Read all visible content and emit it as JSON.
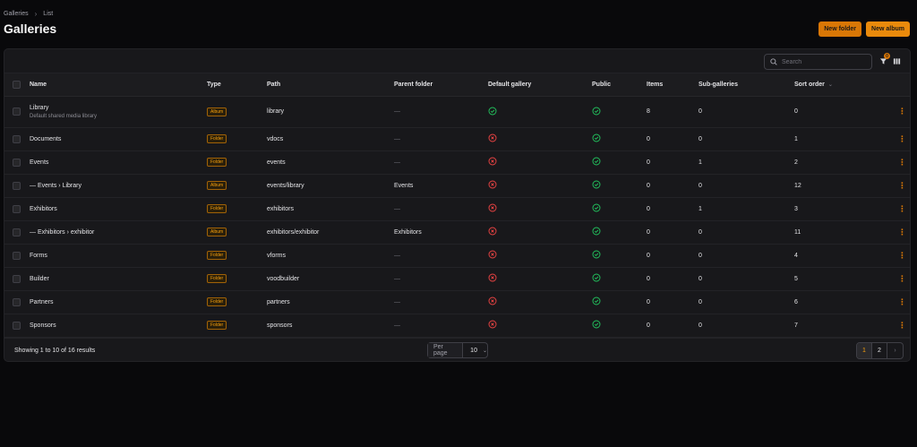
{
  "breadcrumb": {
    "items": [
      "Galleries",
      "List"
    ],
    "separator": "›"
  },
  "page": {
    "title": "Galleries"
  },
  "actions": {
    "new_folder": "New folder",
    "new_album": "New album"
  },
  "toolbar": {
    "search_placeholder": "Search",
    "filter_count": "0",
    "icons": {
      "search": "search-icon",
      "filter": "funnel-icon",
      "columns": "columns-icon"
    }
  },
  "table": {
    "headers": {
      "name": "Name",
      "type": "Type",
      "path": "Path",
      "parent": "Parent folder",
      "default": "Default gallery",
      "public": "Public",
      "items": "Items",
      "subgalleries": "Sub-galleries",
      "sort": "Sort order"
    },
    "rows": [
      {
        "name": "Library",
        "desc": "Default shared media library",
        "type": "Album",
        "path": "library",
        "parent": "—",
        "default": true,
        "public": true,
        "items": "8",
        "sub": "0",
        "sort": "0"
      },
      {
        "name": "Documents",
        "desc": "",
        "type": "Folder",
        "path": "vdocs",
        "parent": "—",
        "default": false,
        "public": true,
        "items": "0",
        "sub": "0",
        "sort": "1"
      },
      {
        "name": "Events",
        "desc": "",
        "type": "Folder",
        "path": "events",
        "parent": "—",
        "default": false,
        "public": true,
        "items": "0",
        "sub": "1",
        "sort": "2"
      },
      {
        "name": "— Events › Library",
        "desc": "",
        "type": "Album",
        "path": "events/library",
        "parent": "Events",
        "default": false,
        "public": true,
        "items": "0",
        "sub": "0",
        "sort": "12"
      },
      {
        "name": "Exhibitors",
        "desc": "",
        "type": "Folder",
        "path": "exhibitors",
        "parent": "—",
        "default": false,
        "public": true,
        "items": "0",
        "sub": "1",
        "sort": "3"
      },
      {
        "name": "— Exhibitors › exhibitor",
        "desc": "",
        "type": "Album",
        "path": "exhibitors/exhibitor",
        "parent": "Exhibitors",
        "default": false,
        "public": true,
        "items": "0",
        "sub": "0",
        "sort": "11"
      },
      {
        "name": "Forms",
        "desc": "",
        "type": "Folder",
        "path": "vforms",
        "parent": "—",
        "default": false,
        "public": true,
        "items": "0",
        "sub": "0",
        "sort": "4"
      },
      {
        "name": "Builder",
        "desc": "",
        "type": "Folder",
        "path": "voodbuilder",
        "parent": "—",
        "default": false,
        "public": true,
        "items": "0",
        "sub": "0",
        "sort": "5"
      },
      {
        "name": "Partners",
        "desc": "",
        "type": "Folder",
        "path": "partners",
        "parent": "—",
        "default": false,
        "public": true,
        "items": "0",
        "sub": "0",
        "sort": "6"
      },
      {
        "name": "Sponsors",
        "desc": "",
        "type": "Folder",
        "path": "sponsors",
        "parent": "—",
        "default": false,
        "public": true,
        "items": "0",
        "sub": "0",
        "sort": "7"
      }
    ]
  },
  "footer": {
    "results": "Showing 1 to 10 of 16 results",
    "per_page_label": "Per page",
    "per_page_value": "10",
    "pages": [
      "1",
      "2"
    ],
    "active_page": "1",
    "next": "›"
  },
  "colors": {
    "accent": "#d97706",
    "success": "#22c55e",
    "danger": "#ef4444",
    "background": "#09090b",
    "panel": "#18181b"
  }
}
